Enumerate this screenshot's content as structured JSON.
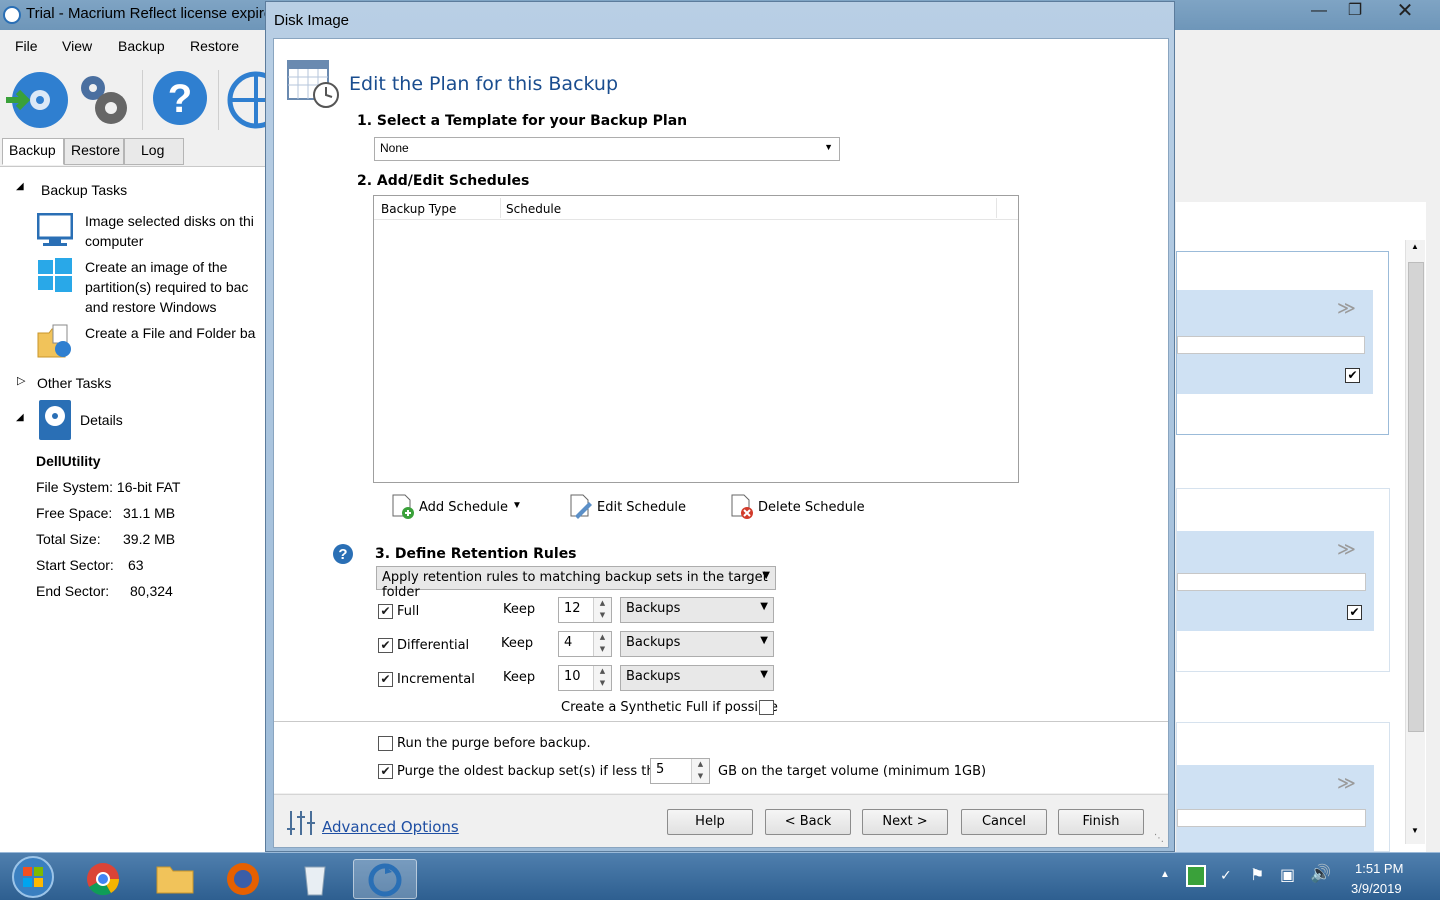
{
  "main_window": {
    "title": "Trial - Macrium Reflect license expire",
    "menu": [
      "File",
      "View",
      "Backup",
      "Restore"
    ],
    "tabs": [
      "Backup",
      "Restore",
      "Log"
    ],
    "backup_tasks_header": "Backup Tasks",
    "tasks": [
      "Image selected disks on thi",
      "computer",
      "Create an image of the",
      "partition(s) required to bac",
      "and restore Windows",
      "Create a File and Folder ba"
    ],
    "other_tasks_header": "Other Tasks",
    "details_header": "Details",
    "details": {
      "name": "DellUtility",
      "file_system": "File System: 16-bit FAT",
      "free_space_label": "Free Space:",
      "free_space_value": "31.1 MB",
      "total_size_label": "Total Size:",
      "total_size_value": "39.2 MB",
      "start_sector_label": "Start Sector:",
      "start_sector_value": "63",
      "end_sector_label": "End Sector:",
      "end_sector_value": "80,324"
    }
  },
  "dialog": {
    "title": "Disk Image",
    "header": "Edit the Plan for this Backup",
    "step1": "1. Select a Template for your Backup Plan",
    "template_value": "None",
    "step2": "2. Add/Edit Schedules",
    "schedule_columns": [
      "Backup Type",
      "Schedule"
    ],
    "add_schedule": "Add Schedule",
    "edit_schedule": "Edit Schedule",
    "delete_schedule": "Delete Schedule",
    "step3": "3. Define Retention Rules",
    "retention_mode": "Apply retention rules to matching backup sets in the target folder",
    "keep_label": "Keep",
    "rules": [
      {
        "label": "Full",
        "checked": true,
        "value": "12",
        "unit": "Backups"
      },
      {
        "label": "Differential",
        "checked": true,
        "value": "4",
        "unit": "Backups"
      },
      {
        "label": "Incremental",
        "checked": true,
        "value": "10",
        "unit": "Backups"
      }
    ],
    "synthetic_label": "Create a Synthetic Full if possible",
    "purge_before_label": "Run the purge before backup.",
    "purge_oldest_label": "Purge the oldest backup set(s) if less than",
    "purge_gb_value": "5",
    "purge_suffix": "GB on the target volume (minimum 1GB)",
    "advanced_options": "Advanced Options",
    "buttons": {
      "help": "Help",
      "back": "< Back",
      "next": "Next >",
      "cancel": "Cancel",
      "finish": "Finish"
    }
  },
  "taskbar": {
    "time": "1:51 PM",
    "date": "3/9/2019"
  },
  "colors": {
    "accent": "#1f4fa3",
    "title_blue": "#1a4d8f",
    "band_blue": "#cfe1f3"
  }
}
